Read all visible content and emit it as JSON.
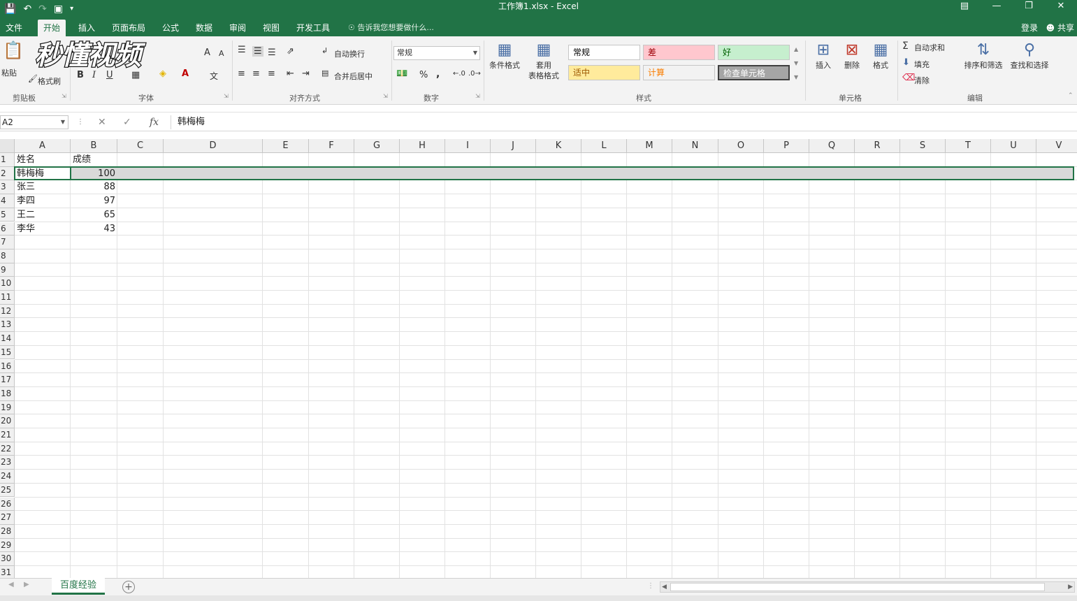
{
  "window": {
    "title": "工作簿1.xlsx - Excel",
    "login": "登录",
    "share": "共享"
  },
  "menu": {
    "tabs": [
      "文件",
      "开始",
      "插入",
      "页面布局",
      "公式",
      "数据",
      "审阅",
      "视图",
      "开发工具"
    ],
    "active": "开始",
    "tell_me": "告诉我您想要做什么..."
  },
  "ribbon": {
    "clipboard": {
      "label": "剪贴板",
      "paste": "粘贴",
      "format_painter": "格式刷"
    },
    "font": {
      "label": "字体",
      "bold": "B",
      "italic": "I",
      "underline": "U",
      "grow": "A",
      "shrink": "A"
    },
    "alignment": {
      "label": "对齐方式",
      "wrap_text": "自动换行",
      "merge_center": "合并后居中"
    },
    "number": {
      "label": "数字",
      "format": "常规",
      "percent": "%",
      "comma": ","
    },
    "styles": {
      "label": "样式",
      "conditional": "条件格式",
      "table_format_1": "套用",
      "table_format_2": "表格格式",
      "cells": [
        {
          "text": "常规",
          "bg": "#ffffff",
          "fg": "#000000"
        },
        {
          "text": "差",
          "bg": "#ffc7ce",
          "fg": "#9c0006"
        },
        {
          "text": "好",
          "bg": "#c6efce",
          "fg": "#006100"
        },
        {
          "text": "适中",
          "bg": "#ffeb9c",
          "fg": "#9c5700"
        },
        {
          "text": "计算",
          "bg": "#f2f2f2",
          "fg": "#fa7d00"
        },
        {
          "text": "检查单元格",
          "bg": "#a5a5a5",
          "fg": "#ffffff"
        }
      ]
    },
    "cells_group": {
      "label": "单元格",
      "insert": "插入",
      "delete": "删除",
      "format": "格式"
    },
    "editing": {
      "label": "编辑",
      "autosum": "自动求和",
      "fill": "填充",
      "clear": "清除",
      "sort_filter": "排序和筛选",
      "find_select": "查找和选择"
    }
  },
  "watermark": {
    "text": "秒懂视频"
  },
  "formula_bar": {
    "name_box": "A2",
    "fx": "fx",
    "value": "韩梅梅"
  },
  "sheet": {
    "columns": [
      "A",
      "B",
      "C",
      "D",
      "E",
      "F",
      "G",
      "H",
      "I",
      "J",
      "K",
      "L",
      "M",
      "N",
      "O",
      "P",
      "Q",
      "R",
      "S",
      "T",
      "U",
      "V"
    ],
    "row_numbers": [
      "1",
      "2",
      "3",
      "4",
      "5",
      "6",
      "7",
      "8",
      "9",
      "10",
      "11",
      "12",
      "13",
      "14",
      "15",
      "16",
      "17",
      "18",
      "19",
      "20",
      "21",
      "22",
      "23",
      "24",
      "25",
      "26",
      "27",
      "28",
      "29",
      "30",
      "31"
    ],
    "header_row": [
      "姓名",
      "成绩"
    ],
    "rows": [
      [
        "韩梅梅",
        "100"
      ],
      [
        "张三",
        "88"
      ],
      [
        "李四",
        "97"
      ],
      [
        "王二",
        "65"
      ],
      [
        "李华",
        "43"
      ]
    ]
  },
  "sheet_tabs": {
    "active": "百度经验",
    "add": "+"
  },
  "colors": {
    "accent": "#217346",
    "selected_row": "#d9d9d9"
  }
}
